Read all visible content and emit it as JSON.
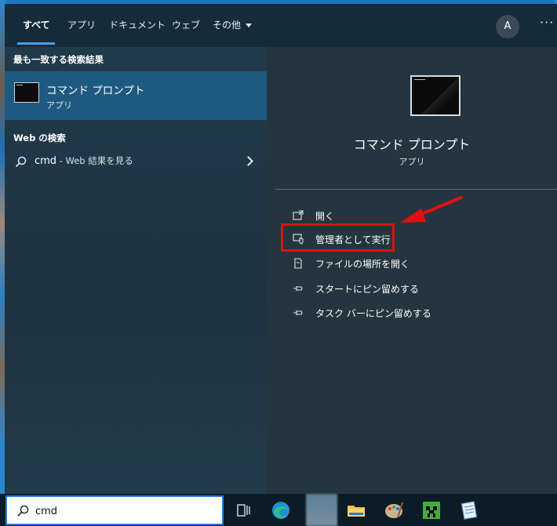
{
  "tabs": [
    {
      "label": "すべて",
      "active": true
    },
    {
      "label": "アプリ"
    },
    {
      "label": "ドキュメント"
    },
    {
      "label": "ウェブ"
    },
    {
      "label": "その他"
    }
  ],
  "account_initial": "A",
  "more_label": "···",
  "left": {
    "best_match_heading": "最も一致する検索結果",
    "best_match": {
      "title": "コマンド プロンプト",
      "subtitle": "アプリ",
      "icon": "command-prompt-icon"
    },
    "web_heading": "Web の検索",
    "web_query": "cmd",
    "web_suffix": " - Web 結果を見る"
  },
  "right": {
    "app_title": "コマンド プロンプト",
    "app_subtitle": "アプリ",
    "actions": [
      {
        "label": "開く",
        "icon": "open-icon"
      },
      {
        "label": "管理者として実行",
        "icon": "shield-run-as-admin-icon"
      },
      {
        "label": "ファイルの場所を開く",
        "icon": "file-location-icon"
      },
      {
        "label": "スタートにピン留めする",
        "icon": "pin-icon"
      },
      {
        "label": "タスク バーにピン留めする",
        "icon": "pin-icon"
      }
    ]
  },
  "taskbar": {
    "search_value": "cmd",
    "icons": [
      "task-view-icon",
      "edge-icon",
      "blurred-app-icon",
      "file-explorer-icon",
      "paint-icon",
      "minecraft-icon",
      "notepad-icon"
    ]
  },
  "colors": {
    "accent": "#3fa0f0",
    "highlight": "#e11010",
    "selected_row": "#1e5a80"
  }
}
